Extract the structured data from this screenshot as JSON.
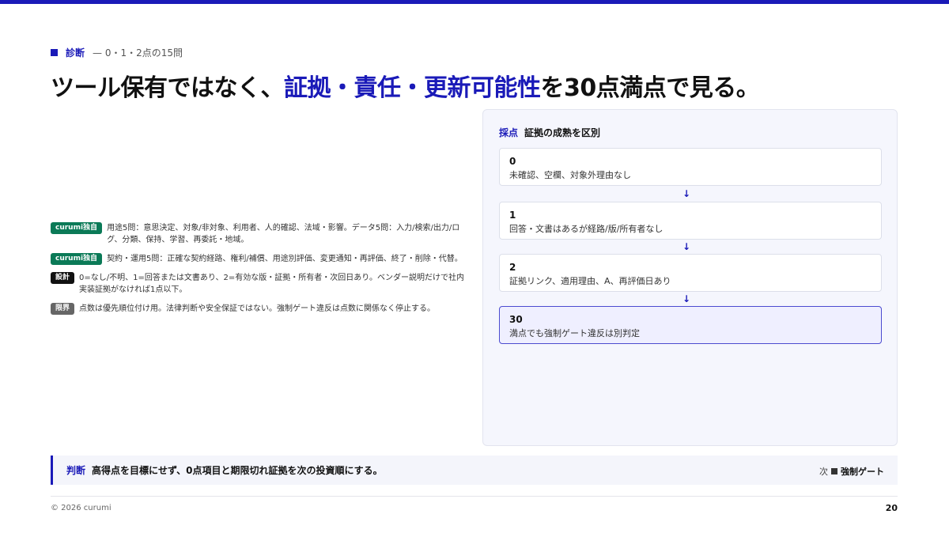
{
  "eyebrow": {
    "kicker": "診断",
    "sub": "— 0・1・2点の15問"
  },
  "headline": {
    "pre": "ツール保有ではなく、",
    "highlight": "証拠・責任・更新可能性",
    "post": "を30点満点で見る。"
  },
  "notes": [
    {
      "tag": "curumi独自",
      "text": "用途5問：意思決定、対象/非対象、利用者、人的確認、法域・影響。データ5問：入力/検索/出力/ログ、分類、保持、学習、再委託・地域。"
    },
    {
      "tag": "curumi独自",
      "text": "契約・運用5問：正確な契約経路、権利/補償、用途別評価、変更通知・再評価、終了・削除・代替。"
    },
    {
      "tag": "設計",
      "text": "0=なし/不明、1=回答または文書あり、2=有効な版・証拠・所有者・次回日あり。ベンダー説明だけで社内実装証拠がなければ1点以下。"
    },
    {
      "tag": "限界",
      "text": "点数は優先順位付け用。法律判断や安全保証ではない。強制ゲート違反は点数に関係なく停止する。"
    }
  ],
  "panel": {
    "kicker": "採点",
    "title": "証拠の成熟を区別",
    "arrow_glyph": "↓",
    "steps": [
      {
        "num": "0",
        "desc": "未確認、空欄、対象外理由なし"
      },
      {
        "num": "1",
        "desc": "回答・文書はあるが経路/版/所有者なし"
      },
      {
        "num": "2",
        "desc": "証拠リンク、適用理由、A、再評価日あり"
      },
      {
        "num": "30",
        "desc": "満点でも強制ゲート違反は別判定"
      }
    ]
  },
  "verdict": {
    "kicker": "判断",
    "text": "高得点を目標にせず、0点項目と期限切れ証拠を次の投資順にする。",
    "next_prefix": "次",
    "next_label": "強制ゲート"
  },
  "footer": {
    "copyright": "© 2026 curumi",
    "page_number": "20"
  },
  "colors": {
    "accent": "#1a1ab8",
    "tag_green": "#0b7a57",
    "tag_black": "#111111",
    "tag_gray": "#666666"
  }
}
